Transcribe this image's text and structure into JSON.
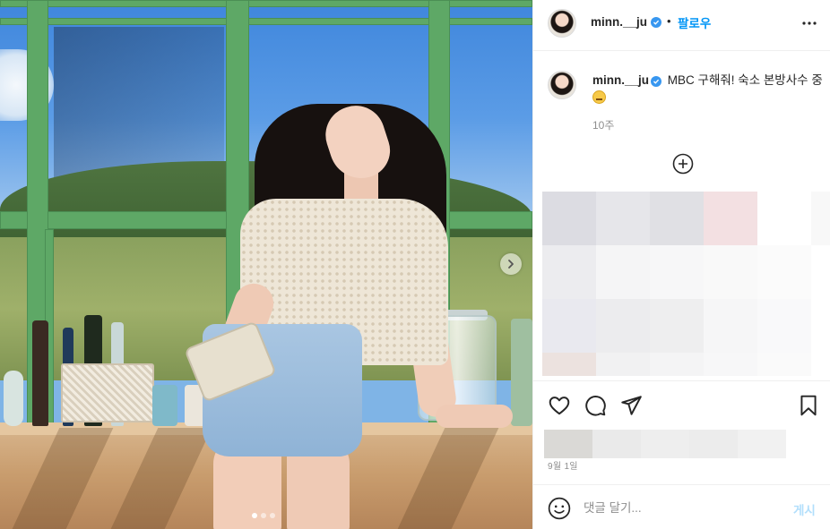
{
  "header": {
    "username": "minn.__ju",
    "separator": "•",
    "follow_label": "팔로우"
  },
  "caption": {
    "username": "minn.__ju",
    "text": "MBC 구해줘! 숙소 본방사수 중",
    "time": "10주"
  },
  "post": {
    "date": "9월 1일"
  },
  "comment": {
    "placeholder": "댓글 달기...",
    "post_label": "게시"
  },
  "carousel": {
    "slide_count": 3,
    "active_slide": 1
  },
  "colors": {
    "accent": "#0095f6",
    "verified": "#3897f0",
    "post_disabled": "#b2dffc",
    "window_frame": "#5ea866"
  },
  "icons": [
    "verified-badge-icon",
    "more-options-icon",
    "load-more-comments-icon",
    "heart-icon",
    "comment-icon",
    "share-icon",
    "bookmark-icon",
    "emoji-icon",
    "carousel-next-icon"
  ]
}
